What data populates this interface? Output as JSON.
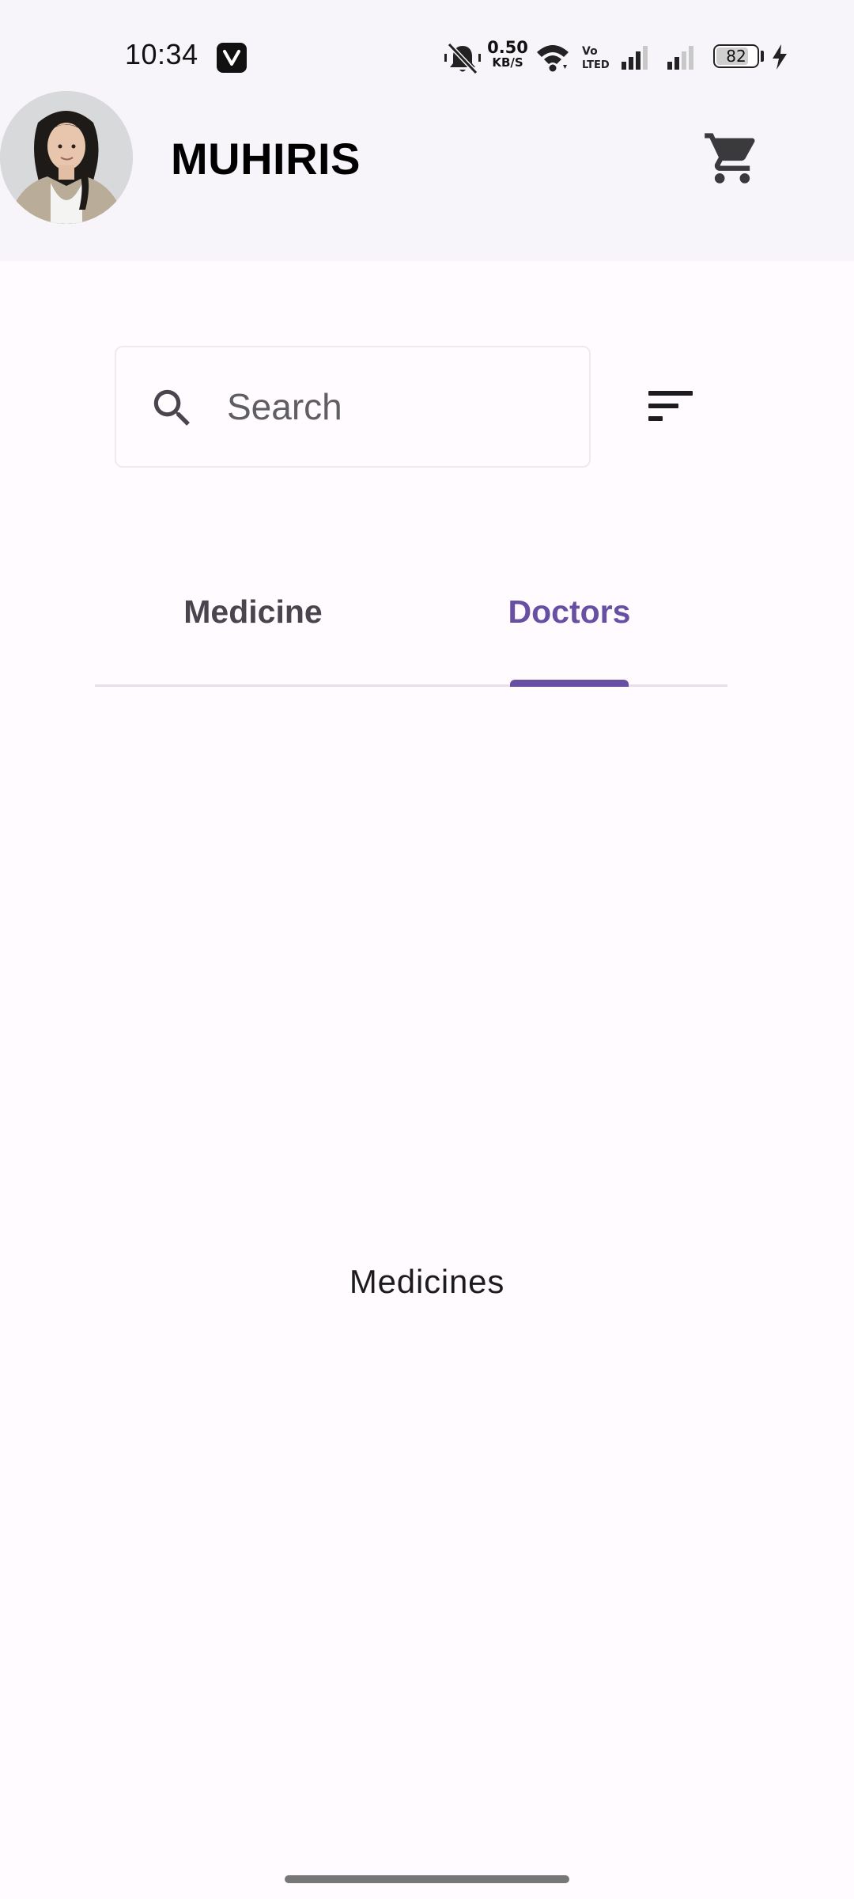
{
  "status_bar": {
    "time": "10:34",
    "app_badge_icon": "v-app-badge-icon",
    "net_speed_value": "0.50",
    "net_speed_unit": "KB/S",
    "battery_percent": "82",
    "battery_level": 0.82,
    "icons": [
      "bell-muted-icon",
      "wifi-icon",
      "volte-icon",
      "signal-icon",
      "signal-weak-icon",
      "charging-icon"
    ]
  },
  "header": {
    "title": "MUHIRIS",
    "avatar_icon": "user-avatar",
    "cart_icon": "shopping-cart-icon"
  },
  "search": {
    "placeholder": "Search",
    "value": "",
    "icon": "search-icon",
    "filter_icon": "filter-sort-icon"
  },
  "tabs": [
    {
      "label": "Medicine",
      "selected": false
    },
    {
      "label": "Doctors",
      "selected": true
    }
  ],
  "content": {
    "text": "Medicines"
  },
  "colors": {
    "accent": "#6750a4",
    "background": "#fffbfe",
    "header_background": "#f8f5fa",
    "text_primary": "#1c1b1f",
    "tab_inactive": "#49454f"
  }
}
